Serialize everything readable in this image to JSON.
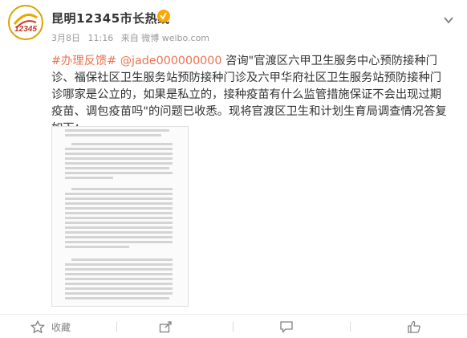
{
  "post": {
    "author": "昆明12345市长热线",
    "avatar_text": "12345",
    "date": "3月8日",
    "time": "11:16",
    "source": "来自 微博 weibo.com",
    "text": {
      "topic": "#办理反馈#",
      "mention": "@jade000000000",
      "body": " 咨询\"官渡区六甲卫生服务中心预防接种门诊、福保社区卫生服务站预防接种门诊及六甲华府社区卫生服务站预防接种门诊哪家是公立的，如果是私立的，接种疫苗有什么监管措施保证不会出现过期疫苗、调包疫苗吗\"的问题已收悉。现将官渡区卫生和计划生育局调查情况答复如下："
    }
  },
  "actions": {
    "favorite": "收藏",
    "share": "",
    "comment": "",
    "like": ""
  },
  "colors": {
    "link": "#eb7350",
    "verified": "#ffa500",
    "avatar_ring": "#d9a300"
  }
}
